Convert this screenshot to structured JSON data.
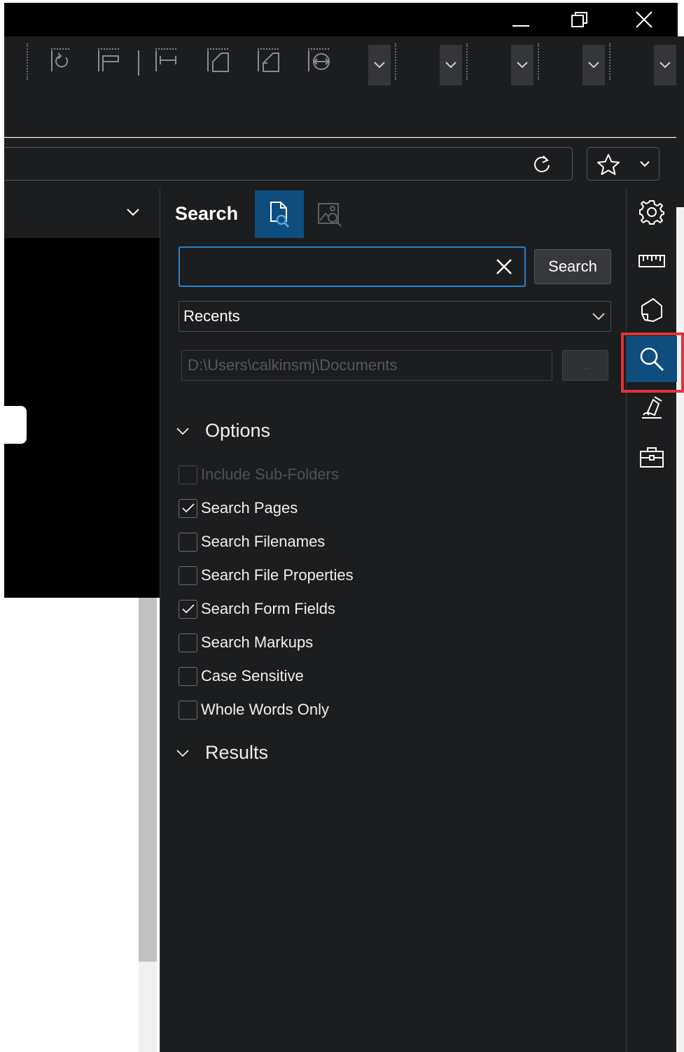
{
  "window": {
    "controls": [
      "minimize",
      "restore",
      "close"
    ]
  },
  "toolbar": {
    "icons": [
      "page-rotate-icon",
      "page-align-icon",
      "fit-width-icon",
      "page-layout-icon",
      "page-crop-icon",
      "compare-icon"
    ],
    "dropdowns": 5
  },
  "address_bar": {
    "refresh_icon": "refresh-icon",
    "favorite_icon": "star-icon"
  },
  "search_panel": {
    "title": "Search",
    "tabs": [
      {
        "name": "text-search",
        "icon": "document-search-icon",
        "active": true
      },
      {
        "name": "image-search",
        "icon": "image-search-icon",
        "active": false
      }
    ],
    "query_value": "",
    "search_button": "Search",
    "scope_selected": "Recents",
    "path_value": "D:\\Users\\calkinsmj\\Documents",
    "browse_button": "...",
    "options_header": "Options",
    "options": [
      {
        "label": "Include Sub-Folders",
        "checked": false,
        "disabled": true
      },
      {
        "label": "Search Pages",
        "checked": true,
        "disabled": false
      },
      {
        "label": "Search Filenames",
        "checked": false,
        "disabled": false
      },
      {
        "label": "Search File Properties",
        "checked": false,
        "disabled": false
      },
      {
        "label": "Search Form Fields",
        "checked": true,
        "disabled": false
      },
      {
        "label": "Search Markups",
        "checked": false,
        "disabled": false
      },
      {
        "label": "Case Sensitive",
        "checked": false,
        "disabled": false
      },
      {
        "label": "Whole Words Only",
        "checked": false,
        "disabled": false
      }
    ],
    "results_header": "Results"
  },
  "side_icons": [
    "gear-icon",
    "ruler-icon",
    "shape-icon",
    "search-icon",
    "signature-icon",
    "toolbox-icon"
  ],
  "colors": {
    "panel_bg": "#1c1d1f",
    "accent": "#0e4d7e",
    "focus_border": "#2a82cc",
    "highlight": "#e0343a"
  }
}
